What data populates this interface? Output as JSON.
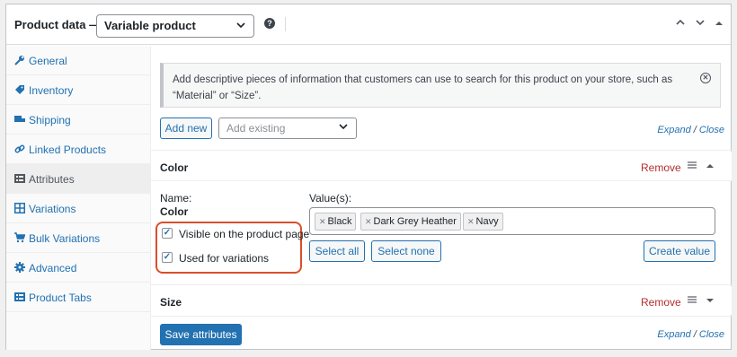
{
  "header": {
    "title": "Product data —",
    "product_type": "Variable product",
    "help": "?"
  },
  "sidebar": {
    "items": [
      {
        "label": "General",
        "icon": "wrench-icon",
        "glyph": "🔧",
        "active": false
      },
      {
        "label": "Inventory",
        "icon": "tag-icon",
        "glyph": "◈",
        "active": false
      },
      {
        "label": "Shipping",
        "icon": "truck-icon",
        "glyph": "■",
        "active": false
      },
      {
        "label": "Linked Products",
        "icon": "link-icon",
        "glyph": "⛓",
        "active": false
      },
      {
        "label": "Attributes",
        "icon": "list-icon",
        "glyph": "▤",
        "active": true
      },
      {
        "label": "Variations",
        "icon": "grid-icon",
        "glyph": "⊞",
        "active": false
      },
      {
        "label": "Bulk Variations",
        "icon": "cart-icon",
        "glyph": "🛒",
        "active": false
      },
      {
        "label": "Advanced",
        "icon": "gear-icon",
        "glyph": "⚙",
        "active": false
      },
      {
        "label": "Product Tabs",
        "icon": "table-icon",
        "glyph": "▤",
        "active": false
      }
    ]
  },
  "notice": {
    "text": "Add descriptive pieces of information that customers can use to search for this product on your store, such as “Material” or “Size”."
  },
  "toolbar": {
    "add_new": "Add new",
    "add_existing_placeholder": "Add existing",
    "expand": "Expand",
    "separator": "/",
    "close": "Close"
  },
  "attributes": [
    {
      "name": "Color",
      "remove": "Remove",
      "expanded": true,
      "name_label": "Name:",
      "visible_label": "Visible on the product page",
      "visible_checked": true,
      "variations_label": "Used for variations",
      "variations_checked": true,
      "values_label": "Value(s):",
      "values": [
        "Black",
        "Dark Grey Heather",
        "Navy"
      ],
      "select_all": "Select all",
      "select_none": "Select none",
      "create_value": "Create value"
    },
    {
      "name": "Size",
      "remove": "Remove",
      "expanded": false
    }
  ],
  "footer": {
    "save": "Save attributes",
    "expand": "Expand",
    "separator": "/",
    "close": "Close"
  },
  "colors": {
    "accent": "#2271b1",
    "remove": "#b32d2e",
    "highlight": "#d94f2b"
  }
}
